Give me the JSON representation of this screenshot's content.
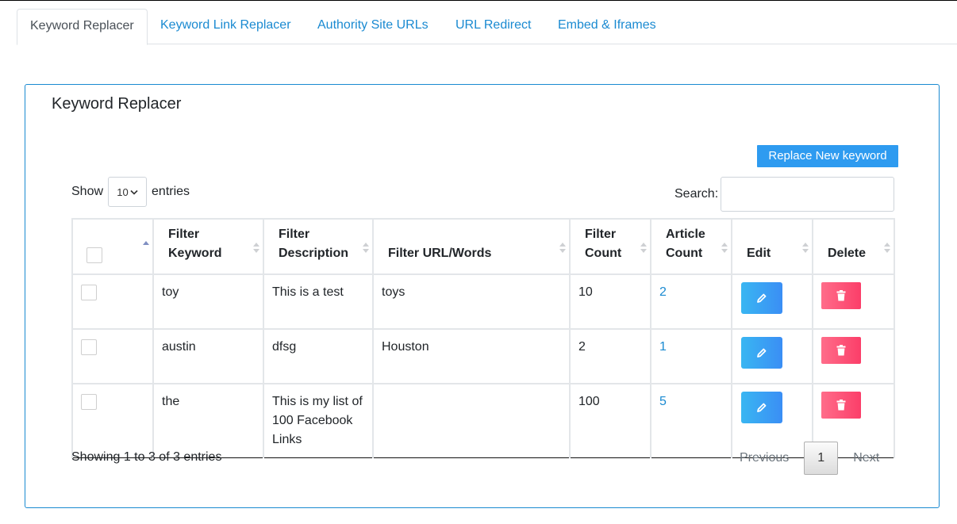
{
  "tabs": [
    {
      "label": "Keyword Replacer",
      "active": true
    },
    {
      "label": "Keyword Link Replacer",
      "active": false
    },
    {
      "label": "Authority Site URLs",
      "active": false
    },
    {
      "label": "URL Redirect",
      "active": false
    },
    {
      "label": "Embed & Iframes",
      "active": false
    }
  ],
  "card": {
    "title": "Keyword Replacer",
    "add_button": "Replace New keyword"
  },
  "length": {
    "show_label": "Show",
    "value": "10",
    "entries_label": "entries"
  },
  "search": {
    "label": "Search:",
    "value": ""
  },
  "table": {
    "headers": {
      "filter_keyword": "Filter Keyword",
      "filter_description": "Filter Description",
      "filter_url": "Filter URL/Words",
      "filter_count": "Filter Count",
      "article_count": "Article Count",
      "edit": "Edit",
      "delete": "Delete"
    },
    "rows": [
      {
        "keyword": "toy",
        "description": "This is a test",
        "url": "toys",
        "filter_count": "10",
        "article_count": "2"
      },
      {
        "keyword": "austin",
        "description": "dfsg",
        "url": "Houston",
        "filter_count": "2",
        "article_count": "1"
      },
      {
        "keyword": "the",
        "description": "This is my list of 100 Facebook Links",
        "url": "",
        "filter_count": "100",
        "article_count": "5"
      }
    ]
  },
  "footer": {
    "info": "Showing 1 to 3 of 3 entries",
    "previous": "Previous",
    "page": "1",
    "next": "Next"
  },
  "icons": {
    "edit": "pencil-icon",
    "delete": "trash-icon",
    "select": "chevron-down-icon"
  },
  "colors": {
    "accent": "#1a8ad1",
    "primary_button": "#2e9bf0",
    "delete_button": "#fb3e69"
  }
}
